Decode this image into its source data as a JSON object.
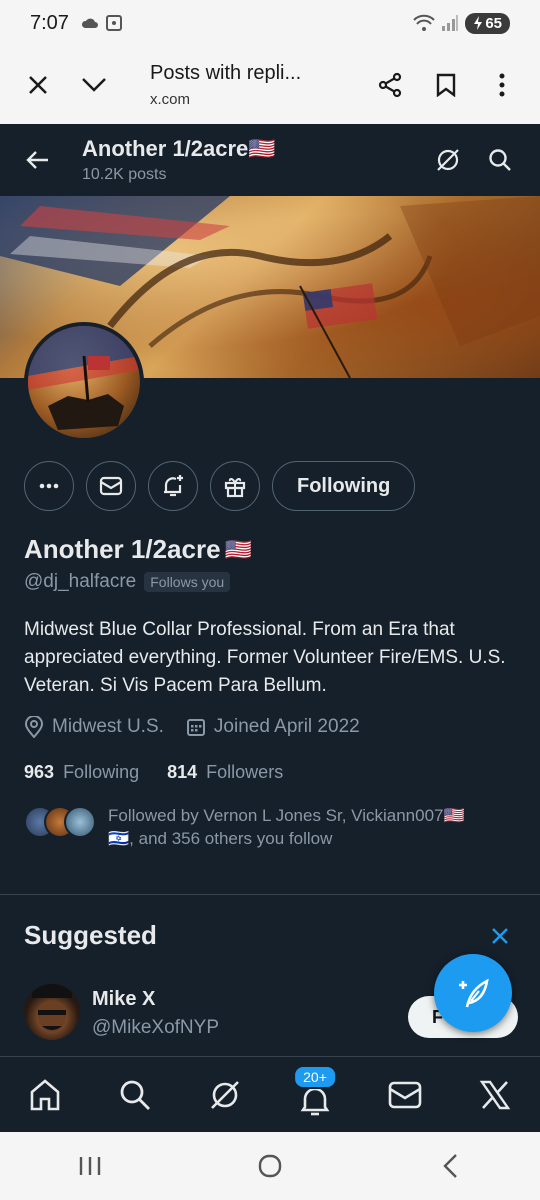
{
  "status_bar": {
    "time": "7:07",
    "battery": "65"
  },
  "browser": {
    "title": "Posts with repli...",
    "domain": "x.com"
  },
  "topnav": {
    "title": "Another 1/2acre🇺🇸",
    "subtitle": "10.2K posts"
  },
  "profile": {
    "name": "Another 1/2acre",
    "flag": "🇺🇸",
    "handle": "@dj_halfacre",
    "follows_you": "Follows you",
    "following_button": "Following",
    "bio": "Midwest Blue Collar Professional. From an Era that appreciated everything. Former Volunteer Fire/EMS. U.S. Veteran. Si Vis Pacem Para Bellum.",
    "location": "Midwest U.S.",
    "joined": "Joined April 2022",
    "following_count": "963",
    "following_label": "Following",
    "followers_count": "814",
    "followers_label": "Followers",
    "followed_by_line1": "Followed by Vernon L Jones Sr, Vickiann007🇺🇸",
    "followed_by_line2": "🇮🇱, and 356 others you follow"
  },
  "suggested": {
    "title": "Suggested",
    "user_name": "Mike X",
    "user_handle": "@MikeXofNYP",
    "follow_label": "F"
  },
  "bottom_nav": {
    "notifications_badge": "20+"
  },
  "colors": {
    "background": "#15202b",
    "accent": "#1d9bf0",
    "text": "#e7e9ea",
    "muted": "#8b98a5"
  }
}
